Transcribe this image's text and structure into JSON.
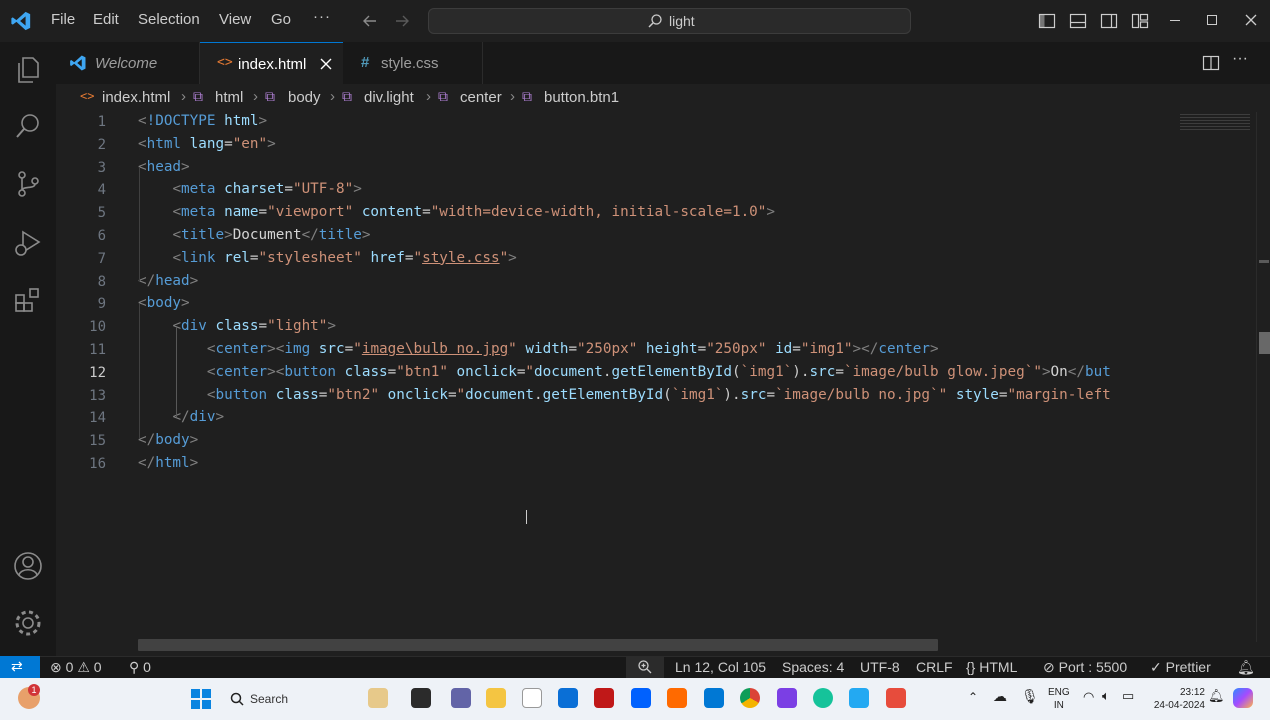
{
  "menu": [
    "File",
    "Edit",
    "Selection",
    "View",
    "Go"
  ],
  "search": {
    "text": "light"
  },
  "tabs": [
    {
      "label": "Welcome",
      "icon": "vscode-icon"
    },
    {
      "label": "index.html",
      "icon": "html-file-icon",
      "active": true
    },
    {
      "label": "style.css",
      "icon": "css-file-icon"
    }
  ],
  "breadcrumb": [
    "index.html",
    "html",
    "body",
    "div.light",
    "center",
    "button.btn1"
  ],
  "lines": [
    {
      "n": "1",
      "html": "<span class='br'>&lt;</span><span class='tag'>!DOCTYPE</span> <span class='at'>html</span><span class='br'>&gt;</span>"
    },
    {
      "n": "2",
      "html": "<span class='br'>&lt;</span><span class='tag'>html</span> <span class='at'>lang</span>=<span class='st'>\"en\"</span><span class='br'>&gt;</span>"
    },
    {
      "n": "3",
      "html": "<span class='br'>&lt;</span><span class='tag'>head</span><span class='br'>&gt;</span>"
    },
    {
      "n": "4",
      "html": "    <span class='br'>&lt;</span><span class='tag'>meta</span> <span class='at'>charset</span>=<span class='st'>\"UTF-8\"</span><span class='br'>&gt;</span>"
    },
    {
      "n": "5",
      "html": "    <span class='br'>&lt;</span><span class='tag'>meta</span> <span class='at'>name</span>=<span class='st'>\"viewport\"</span> <span class='at'>content</span>=<span class='st'>\"width=device-width, initial-scale=1.0\"</span><span class='br'>&gt;</span>"
    },
    {
      "n": "6",
      "html": "    <span class='br'>&lt;</span><span class='tag'>title</span><span class='br'>&gt;</span><span class='tx'>Document</span><span class='br'>&lt;/</span><span class='tag'>title</span><span class='br'>&gt;</span>"
    },
    {
      "n": "7",
      "html": "    <span class='br'>&lt;</span><span class='tag'>link</span> <span class='at'>rel</span>=<span class='st'>\"stylesheet\"</span> <span class='at'>href</span>=<span class='st'>\"<span class='ul'>style.css</span>\"</span><span class='br'>&gt;</span>"
    },
    {
      "n": "8",
      "html": "<span class='br'>&lt;/</span><span class='tag'>head</span><span class='br'>&gt;</span>"
    },
    {
      "n": "9",
      "html": "<span class='br'>&lt;</span><span class='tag'>body</span><span class='br'>&gt;</span>"
    },
    {
      "n": "10",
      "html": "    <span class='br'>&lt;</span><span class='tag'>div</span> <span class='at'>class</span>=<span class='st'>\"light\"</span><span class='br'>&gt;</span>"
    },
    {
      "n": "11",
      "html": "        <span class='br'>&lt;</span><span class='tag'>center</span><span class='br'>&gt;&lt;</span><span class='tag'>img</span> <span class='at'>src</span>=<span class='st'>\"<span class='ul'>image\\bulb no.jpg</span>\"</span> <span class='at'>width</span>=<span class='st'>\"250px\"</span> <span class='at'>height</span>=<span class='st'>\"250px\"</span> <span class='at'>id</span>=<span class='st'>\"img1\"</span><span class='br'>&gt;&lt;/</span><span class='tag'>center</span><span class='br'>&gt;</span>"
    },
    {
      "n": "12",
      "html": "        <span class='br'>&lt;</span><span class='tag'>center</span><span class='br'>&gt;&lt;</span><span class='tag'>button</span> <span class='at'>class</span>=<span class='st'>\"btn1\"</span> <span class='at'>onclick</span>=<span class='st'>\"</span><span class='at'>document</span>.<span class='at'>getElementById</span>(<span class='st'>`img1`</span>).<span class='at'>src</span>=<span class='st'>`image/bulb glow.jpeg`</span><span class='st'>\"</span><span class='br'>&gt;</span><span class='tx'>On</span><span class='br'>&lt;/</span><span class='tag'>but</span>"
    },
    {
      "n": "13",
      "html": "        <span class='br'>&lt;</span><span class='tag'>button</span> <span class='at'>class</span>=<span class='st'>\"btn2\"</span> <span class='at'>onclick</span>=<span class='st'>\"</span><span class='at'>document</span>.<span class='at'>getElementById</span>(<span class='st'>`img1`</span>).<span class='at'>src</span>=<span class='st'>`image/bulb no.jpg`</span><span class='st'>\"</span> <span class='at'>style</span>=<span class='st'>\"margin-left</span>"
    },
    {
      "n": "14",
      "html": "    <span class='br'>&lt;/</span><span class='tag'>div</span><span class='br'>&gt;</span>"
    },
    {
      "n": "15",
      "html": "<span class='br'>&lt;/</span><span class='tag'>body</span><span class='br'>&gt;</span>"
    },
    {
      "n": "16",
      "html": "<span class='br'>&lt;/</span><span class='tag'>html</span><span class='br'>&gt;</span>"
    }
  ],
  "status": {
    "errors": "0",
    "warnings": "0",
    "ports": "0",
    "position": "Ln 12, Col 105",
    "spaces": "Spaces: 4",
    "encoding": "UTF-8",
    "eol": "CRLF",
    "language": "HTML",
    "port": "Port : 5500",
    "prettier": "Prettier"
  },
  "taskbar": {
    "search_label": "Search",
    "lang1": "ENG",
    "lang2": "IN",
    "time": "23:12",
    "date": "24-04-2024",
    "badge": "1"
  },
  "colors": {
    "accent": "#0078d4",
    "editor_bg": "#1f1f1f",
    "sidebar_bg": "#181818"
  }
}
